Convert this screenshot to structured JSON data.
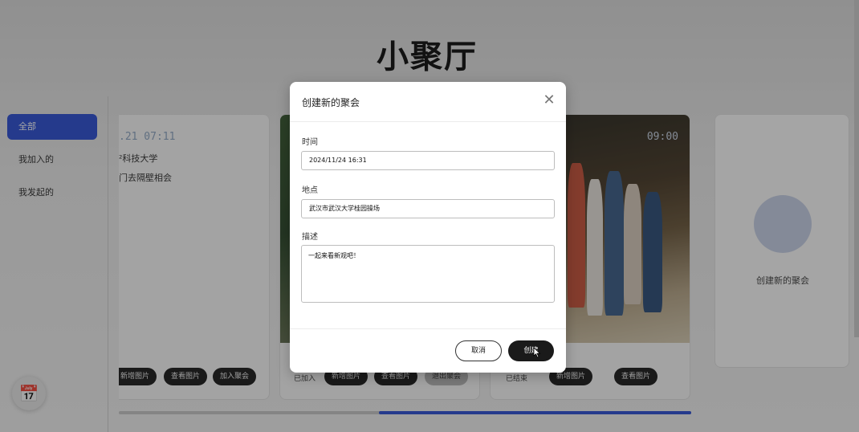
{
  "page": {
    "title": "小聚厅"
  },
  "sidebar": {
    "items": [
      {
        "label": "全部",
        "active": true
      },
      {
        "label": "我加入的",
        "active": false
      },
      {
        "label": "我发起的",
        "active": false
      }
    ]
  },
  "cards": [
    {
      "time": ".21  07:11",
      "school": "²科技大学",
      "desc": "门去隔壁相会",
      "actions": [
        "新增图片",
        "查看图片",
        "加入聚会"
      ]
    },
    {
      "status": "已加入",
      "actions": [
        "新增图片",
        "查看图片",
        "退出聚会"
      ]
    },
    {
      "time": "09:00",
      "status": "已结束",
      "actions": [
        "新增图片",
        "查看图片"
      ]
    }
  ],
  "create_card": {
    "label": "创建新的聚会"
  },
  "colors": {
    "accent": "#2f52d6",
    "dark_button": "#1a1a1a"
  },
  "modal": {
    "title": "创建新的聚会",
    "close_icon": "close-icon",
    "fields": {
      "time_label": "时间",
      "time_value": "2024/11/24 16:31",
      "place_label": "地点",
      "place_value": "武汉市武汉大学桂园操场",
      "desc_label": "描述",
      "desc_value": "一起来看新观吧！"
    },
    "cancel_label": "取消",
    "create_label": "创建"
  }
}
